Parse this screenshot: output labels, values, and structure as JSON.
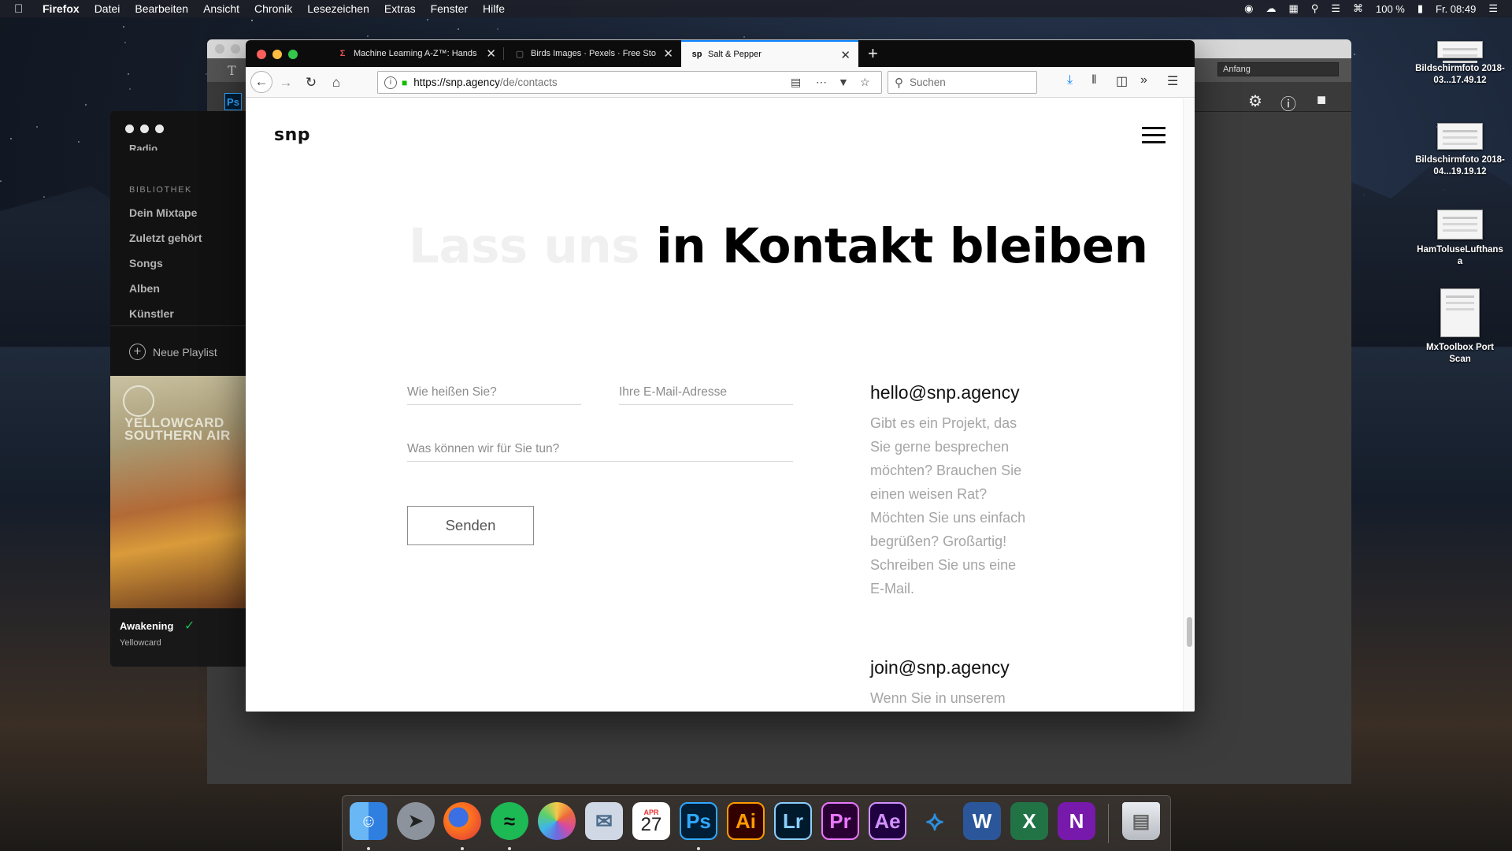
{
  "menubar": {
    "app": "Firefox",
    "items": [
      "Datei",
      "Bearbeiten",
      "Ansicht",
      "Chronik",
      "Lesezeichen",
      "Extras",
      "Fenster",
      "Hilfe"
    ],
    "battery": "100 %",
    "clock": "Fr. 08:49",
    "icons": [
      "creative-cloud-icon",
      "cloud-icon",
      "stats-icon",
      "search-icon",
      "wifi-icon",
      "battery-icon",
      "notification-icon"
    ]
  },
  "desktop": {
    "icons": [
      {
        "label": "Bildschirmfoto 2018-03...17.49.12"
      },
      {
        "label": "Bildschirmfoto 2018-04...19.19.12"
      },
      {
        "label": "HamToluseLufthansa"
      },
      {
        "label": "MxToolbox Port Scan"
      }
    ]
  },
  "photoshop": {
    "type_tool": "T",
    "ps_badge": "Ps",
    "preset_select": "Anfang"
  },
  "spotify": {
    "radio": "Radio",
    "library_heading": "BIBLIOTHEK",
    "library": [
      "Dein Mixtape",
      "Zuletzt gehört",
      "Songs",
      "Alben",
      "Künstler"
    ],
    "new_playlist": "Neue Playlist",
    "album_text": "YELLOWCARD SOUTHERN AIR",
    "now_playing": {
      "title": "Awakening",
      "artist": "Yellowcard"
    }
  },
  "firefox": {
    "tabs": [
      {
        "label": "Machine Learning A-Z™: Hands",
        "favicon": "udemy-icon"
      },
      {
        "label": "Birds Images · Pexels · Free Sto",
        "favicon": "pexels-icon"
      },
      {
        "label": "Salt & Pepper",
        "favicon": "sp",
        "active": true
      }
    ],
    "url_prefix": "https://snp.agency",
    "url_path": "/de/contacts",
    "search_placeholder": "Suchen"
  },
  "page": {
    "logo": "snp",
    "hero_ghost": "Lass uns",
    "hero_solid": "in Kontakt bleiben",
    "form": {
      "name_placeholder": "Wie heißen Sie?",
      "email_placeholder": "Ihre E-Mail-Adresse",
      "message_placeholder": "Was können wir für Sie tun?",
      "submit": "Senden"
    },
    "contact1": {
      "email": "hello@snp.agency",
      "lines": [
        "Gibt es ein Projekt, das",
        "Sie gerne besprechen",
        "möchten? Brauchen Sie",
        "einen weisen Rat?",
        "Möchten Sie uns einfach",
        "begrüßen? Großartig!",
        "Schreiben Sie uns eine",
        "E-Mail."
      ]
    },
    "contact2": {
      "email": "join@snp.agency",
      "lines": [
        "Wenn Sie in unserem"
      ]
    }
  },
  "dock": {
    "apps": [
      "Finder",
      "Launchpad",
      "Firefox",
      "Spotify",
      "Fotos",
      "Mail",
      "Kalender",
      "Photoshop",
      "Illustrator",
      "Lightroom",
      "Premiere",
      "After Effects",
      "Visual Studio Code",
      "Word",
      "Excel",
      "OneNote",
      "Papierkorb"
    ],
    "calendar_month": "APR",
    "calendar_day": "27",
    "labels": {
      "ps": "Ps",
      "ai": "Ai",
      "lr": "Lr",
      "pr": "Pr",
      "ae": "Ae",
      "w": "W",
      "x": "X",
      "n": "N"
    }
  }
}
